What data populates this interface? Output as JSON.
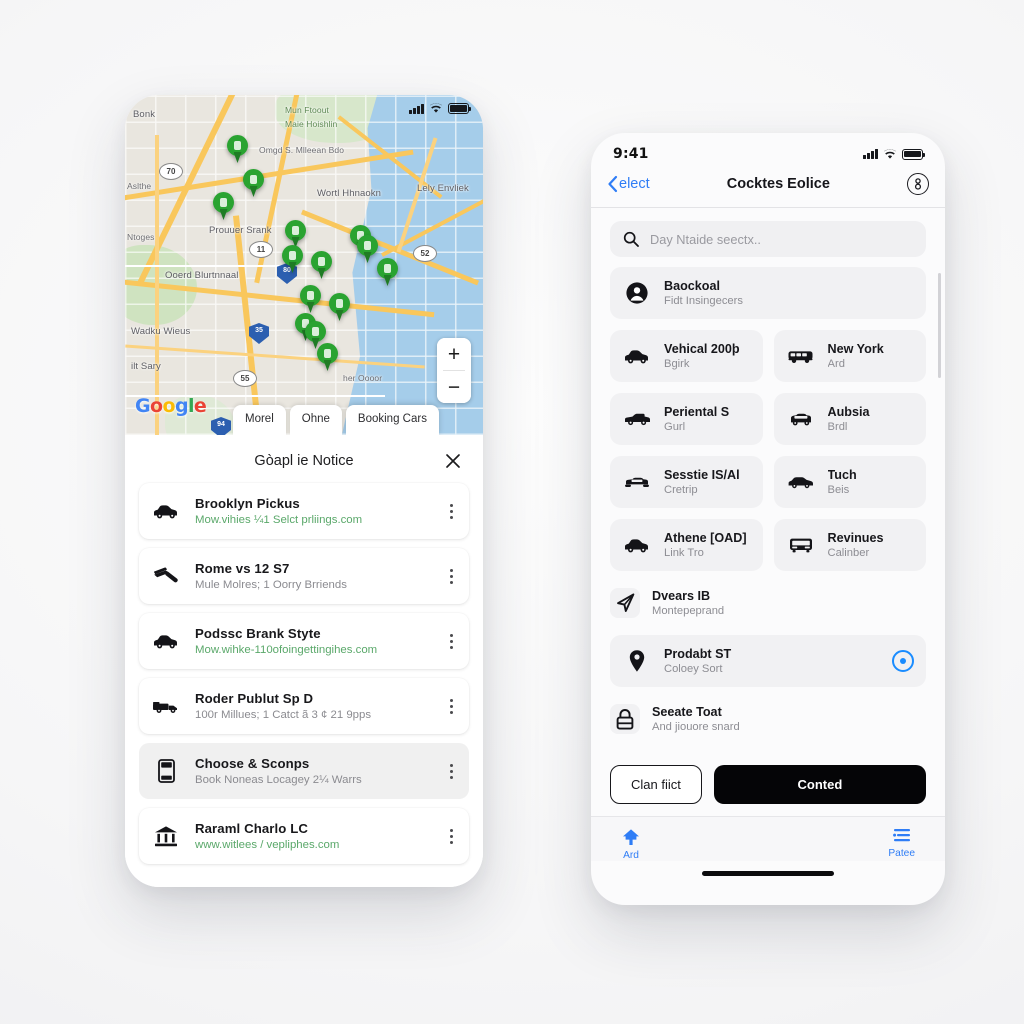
{
  "left_phone": {
    "status_bar": {
      "signal_icon": "cellular-bars-icon",
      "wifi_icon": "wifi-icon",
      "battery_icon": "battery-icon"
    },
    "map": {
      "provider_logo": "Google",
      "logo_letters": [
        "G",
        "o",
        "o",
        "g",
        "l",
        "e"
      ],
      "zoom_in_label": "+",
      "zoom_out_label": "−",
      "labels": [
        "Bonk",
        "Mun Ftoout",
        "Maie Hoishlin",
        "Omgd S. Mlleean Bdo",
        "Wortl Hhnaokn",
        "Lely Envliek",
        "Prouuer Srank",
        "Ooerd Blurtnnaal",
        "Wadku Wieus",
        "ilt Sary",
        "Ntoges",
        "Aslthe",
        "her Oooor"
      ],
      "shield_labels": [
        "I‑80",
        "I‑35",
        "I‑94"
      ],
      "oval_labels": [
        "70",
        "11",
        "55",
        "52"
      ],
      "pin_count": 14,
      "chips": [
        {
          "label": "Morel",
          "active": false
        },
        {
          "label": "Ohne",
          "active": false
        },
        {
          "label": "Booking Cars",
          "active": true
        }
      ]
    },
    "sheet": {
      "title": "Gòapl ie Notice",
      "close_icon": "close-icon",
      "rows": [
        {
          "icon": "car-icon",
          "title": "Brooklyn Pickus",
          "subtitle": "Mow.vihies ¼1 Selct prliings.com",
          "subtitle_style": "green",
          "selected": false,
          "menu_icon": "kebab-menu-icon"
        },
        {
          "icon": "paint-roller-icon",
          "title": "Rome vs 12 S7",
          "subtitle": "Mule Molres; 1 Oorry Brriends",
          "subtitle_style": "muted",
          "selected": false,
          "menu_icon": "kebab-menu-icon"
        },
        {
          "icon": "car-icon",
          "title": "Podssc Brank Styte",
          "subtitle": "Mow.wihke-110ofoingettingihes.com",
          "subtitle_style": "green",
          "selected": false,
          "menu_icon": "kebab-menu-icon"
        },
        {
          "icon": "truck-icon",
          "title": "Roder Publut Sp D",
          "subtitle": "100r Millues; 1 Catct ã 3 ¢ 21 9pps",
          "subtitle_style": "muted",
          "selected": false,
          "menu_icon": "kebab-menu-icon"
        },
        {
          "icon": "phone-device-icon",
          "title": "Choose & Sconps",
          "subtitle": "Book Noneas Locagey 2¼ Warrs",
          "subtitle_style": "muted",
          "selected": true,
          "menu_icon": "kebab-menu-icon"
        },
        {
          "icon": "bank-icon",
          "title": "Raraml Charlo LC",
          "subtitle": "www.witlees / vepliphes.com",
          "subtitle_style": "green",
          "selected": false,
          "menu_icon": "kebab-menu-icon"
        }
      ]
    }
  },
  "right_phone": {
    "status_bar": {
      "time": "9:41",
      "signal_icon": "cellular-bars-icon",
      "wifi_icon": "wifi-icon",
      "battery_icon": "battery-icon"
    },
    "navbar": {
      "back_icon": "chevron-left-icon",
      "back_label": "elect",
      "title": "Cocktes Eolice",
      "info_icon": "info-circle-icon"
    },
    "search": {
      "icon": "search-icon",
      "placeholder": "Day Ntaide seectx..",
      "value": ""
    },
    "options": [
      {
        "icon": "user-circle-icon",
        "title": "Baockoal",
        "subtitle": "Fidt Insingecers",
        "full_width": true,
        "shaded": true,
        "selected": false
      },
      {
        "icon": "car-icon",
        "title": "Vehical 200þ",
        "subtitle": "Bgirk",
        "full_width": false,
        "shaded": true,
        "selected": false
      },
      {
        "icon": "van-icon",
        "title": "New York",
        "subtitle": "Ard",
        "full_width": false,
        "shaded": true,
        "selected": false
      },
      {
        "icon": "pickup-icon",
        "title": "Periental S",
        "subtitle": "Gurl",
        "full_width": false,
        "shaded": true,
        "selected": false
      },
      {
        "icon": "suv-icon",
        "title": "Aubsia",
        "subtitle": "Brdl",
        "full_width": false,
        "shaded": true,
        "selected": false
      },
      {
        "icon": "car-front-icon",
        "title": "Sesstie IS/Al",
        "subtitle": "Cretrip",
        "full_width": false,
        "shaded": true,
        "selected": false
      },
      {
        "icon": "sedan-icon",
        "title": "Tuch",
        "subtitle": "Beis",
        "full_width": false,
        "shaded": true,
        "selected": false
      },
      {
        "icon": "car-icon",
        "title": "Athene [OAD]",
        "subtitle": "Link Tro",
        "full_width": false,
        "shaded": true,
        "selected": false
      },
      {
        "icon": "bus-icon",
        "title": "Revinues",
        "subtitle": "Calinber",
        "full_width": false,
        "shaded": true,
        "selected": false
      },
      {
        "icon": "send-icon",
        "title": "Dvears IB",
        "subtitle": "Montepeprand",
        "full_width": true,
        "shaded": false,
        "selected": false
      },
      {
        "icon": "location-pin-icon",
        "title": "Prodabt ST",
        "subtitle": "Coloey Sort",
        "full_width": true,
        "shaded": true,
        "selected": true
      },
      {
        "icon": "lock-icon",
        "title": "Seeate Toat",
        "subtitle": "And jiouore snard",
        "full_width": true,
        "shaded": false,
        "selected": false
      }
    ],
    "actions": {
      "secondary_label": "Clan fiict",
      "primary_label": "Conted"
    },
    "tabbar": [
      {
        "icon": "home-icon",
        "label": "Ard",
        "active": true
      },
      {
        "icon": "list-icon",
        "label": "Patee",
        "active": true
      }
    ],
    "accent_color": "#2f7df6",
    "selected_color": "#1a8cff",
    "primary_button_color": "#050507"
  }
}
